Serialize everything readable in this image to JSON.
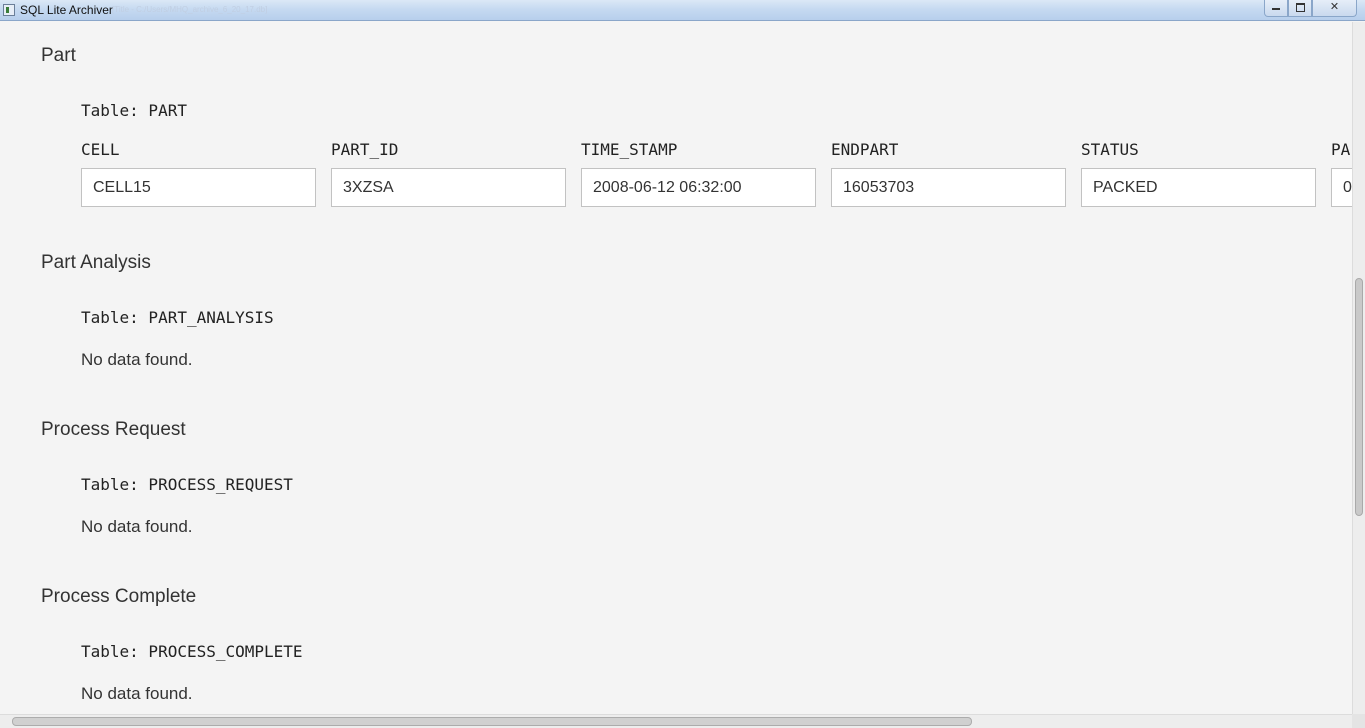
{
  "window": {
    "title": "SQL Lite Archiver",
    "path": "[Title - C:/Users/MHQ_archive_6_20_17.db]"
  },
  "sections": [
    {
      "title": "Part",
      "table_label": "Table: PART",
      "columns": [
        {
          "header": "CELL",
          "value": "CELL15"
        },
        {
          "header": "PART_ID",
          "value": "3XZSA"
        },
        {
          "header": "TIME_STAMP",
          "value": "2008-06-12 06:32:00"
        },
        {
          "header": "ENDPART",
          "value": "16053703"
        },
        {
          "header": "STATUS",
          "value": "PACKED"
        },
        {
          "header": "PA",
          "value": "0"
        }
      ]
    },
    {
      "title": "Part Analysis",
      "table_label": "Table: PART_ANALYSIS",
      "message": "No data found."
    },
    {
      "title": "Process Request",
      "table_label": "Table: PROCESS_REQUEST",
      "message": "No data found."
    },
    {
      "title": "Process Complete",
      "table_label": "Table: PROCESS_COMPLETE",
      "message": "No data found."
    }
  ]
}
